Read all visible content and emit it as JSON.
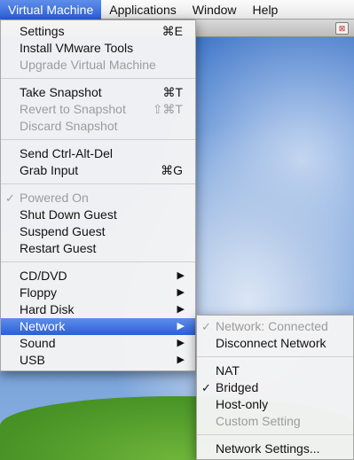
{
  "menubar": {
    "items": [
      "Virtual Machine",
      "Applications",
      "Window",
      "Help"
    ]
  },
  "main_menu": {
    "settings": {
      "label": "Settings",
      "shortcut": "⌘E"
    },
    "install_tools": {
      "label": "Install VMware Tools"
    },
    "upgrade_vm": {
      "label": "Upgrade Virtual Machine"
    },
    "take_snapshot": {
      "label": "Take Snapshot",
      "shortcut": "⌘T"
    },
    "revert_snapshot": {
      "label": "Revert to Snapshot",
      "shortcut": "⇧⌘T"
    },
    "discard_snapshot": {
      "label": "Discard Snapshot"
    },
    "send_ctrl_alt_del": {
      "label": "Send Ctrl-Alt-Del"
    },
    "grab_input": {
      "label": "Grab Input",
      "shortcut": "⌘G"
    },
    "powered_on": {
      "label": "Powered On"
    },
    "shut_down": {
      "label": "Shut Down Guest"
    },
    "suspend": {
      "label": "Suspend Guest"
    },
    "restart": {
      "label": "Restart Guest"
    },
    "cd_dvd": {
      "label": "CD/DVD"
    },
    "floppy": {
      "label": "Floppy"
    },
    "hard_disk": {
      "label": "Hard Disk"
    },
    "network": {
      "label": "Network"
    },
    "sound": {
      "label": "Sound"
    },
    "usb": {
      "label": "USB"
    }
  },
  "network_menu": {
    "status": {
      "label": "Network: Connected"
    },
    "disconnect": {
      "label": "Disconnect Network"
    },
    "nat": {
      "label": "NAT"
    },
    "bridged": {
      "label": "Bridged"
    },
    "host_only": {
      "label": "Host-only"
    },
    "custom": {
      "label": "Custom Setting"
    },
    "settings": {
      "label": "Network Settings..."
    }
  },
  "glyphs": {
    "check": "✓",
    "arrow": "▶",
    "close": "⊠"
  },
  "colors": {
    "highlight": "#2a5fd7",
    "disabled_text": "#9c9c9c"
  }
}
